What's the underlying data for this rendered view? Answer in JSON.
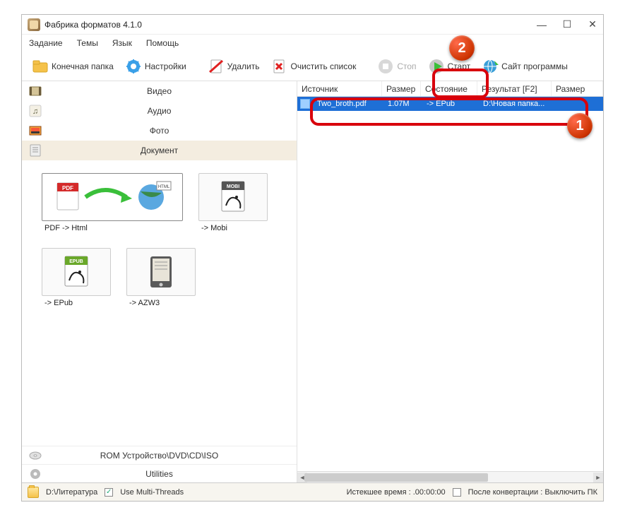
{
  "title": "Фабрика форматов 4.1.0",
  "menu": {
    "task": "Задание",
    "themes": "Темы",
    "lang": "Язык",
    "help": "Помощь"
  },
  "toolbar": {
    "output_folder": "Конечная папка",
    "settings": "Настройки",
    "remove": "Удалить",
    "clear": "Очистить список",
    "stop": "Стоп",
    "start": "Старт",
    "site": "Сайт программы"
  },
  "categories": {
    "video": "Видео",
    "audio": "Аудио",
    "photo": "Фото",
    "document": "Документ",
    "rom": "ROM Устройство\\DVD\\CD\\ISO",
    "utilities": "Utilities"
  },
  "formats": {
    "pdf_html": "PDF -> Html",
    "mobi": "-> Mobi",
    "epub": "-> EPub",
    "azw3": "-> AZW3"
  },
  "columns": {
    "source": "Источник",
    "size": "Размер",
    "state": "Состояние",
    "result": "Результат [F2]",
    "size2": "Размер"
  },
  "row": {
    "source": "Two_broth.pdf",
    "size": "1.07M",
    "state": "-> EPub",
    "result": "D:\\Новая папка..."
  },
  "status": {
    "path": "D:\\Литература",
    "multi": "Use Multi-Threads",
    "elapsed": "Истекшее время : .00:00:00",
    "after": "После конвертации : Выключить ПК"
  },
  "callouts": {
    "start": "2",
    "row": "1"
  }
}
